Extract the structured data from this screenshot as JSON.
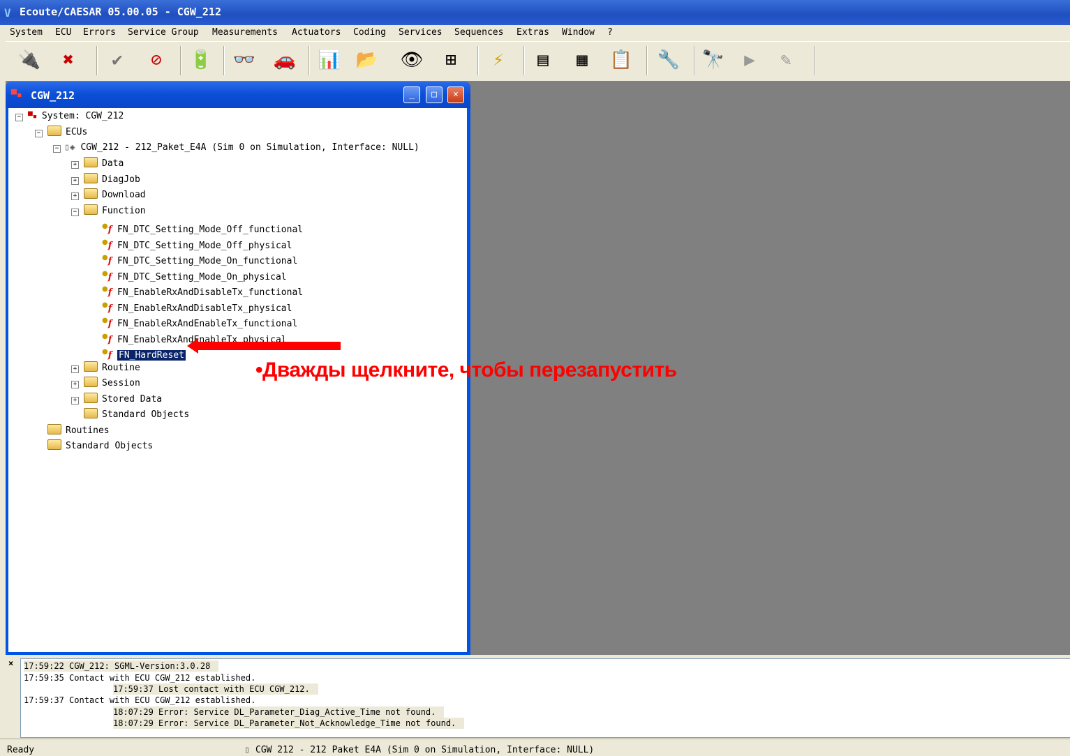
{
  "app": {
    "title": "Ecoute/CAESAR 05.00.05 - CGW_212"
  },
  "menu": [
    "System",
    "ECU",
    "Errors",
    "Service Group",
    "Measurements",
    "Actuators",
    "Coding",
    "Services",
    "Sequences",
    "Extras",
    "Window",
    "?"
  ],
  "toolbar": {
    "icons": [
      "connect-icon",
      "disconnect-icon",
      "check-icon",
      "cancel-icon",
      "ecu-info-icon",
      "glasses-icon",
      "car-icon",
      "measurements-icon",
      "folder-arrow-icon",
      "eye-icon",
      "tree-view-icon",
      "flash-icon",
      "document-icon",
      "data-table-icon",
      "sequence-icon",
      "tools-icon",
      "binoculars-icon",
      "plug-icon",
      "unplug-icon"
    ],
    "glyphs": [
      "🔌",
      "✖",
      "✔",
      "⊘",
      "🔋",
      "👓",
      "🚗",
      "📊",
      "📂",
      "👁",
      "⊞",
      "⚡",
      "▤",
      "▦",
      "📋",
      "🔧",
      "🔭",
      "▶",
      "✎"
    ]
  },
  "child_window": {
    "title": "CGW_212",
    "btn_minimize": "_",
    "btn_maximize": "□",
    "btn_close": "×"
  },
  "tree": {
    "system": "System: CGW_212",
    "ecus": "ECUs",
    "ecu": "CGW_212 - 212_Paket_E4A (Sim 0 on Simulation, Interface: NULL)",
    "data": "Data",
    "diagjob": "DiagJob",
    "download": "Download",
    "function": "Function",
    "functions": [
      "FN_DTC_Setting_Mode_Off_functional",
      "FN_DTC_Setting_Mode_Off_physical",
      "FN_DTC_Setting_Mode_On_functional",
      "FN_DTC_Setting_Mode_On_physical",
      "FN_EnableRxAndDisableTx_functional",
      "FN_EnableRxAndDisableTx_physical",
      "FN_EnableRxAndEnableTx_functional",
      "FN_EnableRxAndEnableTx_physical",
      "FN_HardReset"
    ],
    "routine": "Routine",
    "session": "Session",
    "stored_data": "Stored Data",
    "standard_objects_ecu": "Standard Objects",
    "routines": "Routines",
    "standard_objects": "Standard Objects"
  },
  "annotation": {
    "text": "•Дважды  щелкните,   чтобы  перезапустить"
  },
  "log": {
    "close": "×",
    "lines": [
      "17:59:22 CGW_212: SGML-Version:3.0.28",
      "17:59:35 Contact with ECU CGW_212 established.",
      "17:59:37 Lost contact with ECU CGW_212.",
      "17:59:37 Contact with ECU CGW_212 established.",
      "18:07:29 Error: Service DL_Parameter_Diag_Active_Time not found.",
      "18:07:29 Error: Service DL_Parameter_Not_Acknowledge_Time not found."
    ]
  },
  "status": {
    "ready": "Ready",
    "ecu": "CGW 212 - 212 Paket E4A (Sim 0 on Simulation, Interface: NULL)"
  }
}
